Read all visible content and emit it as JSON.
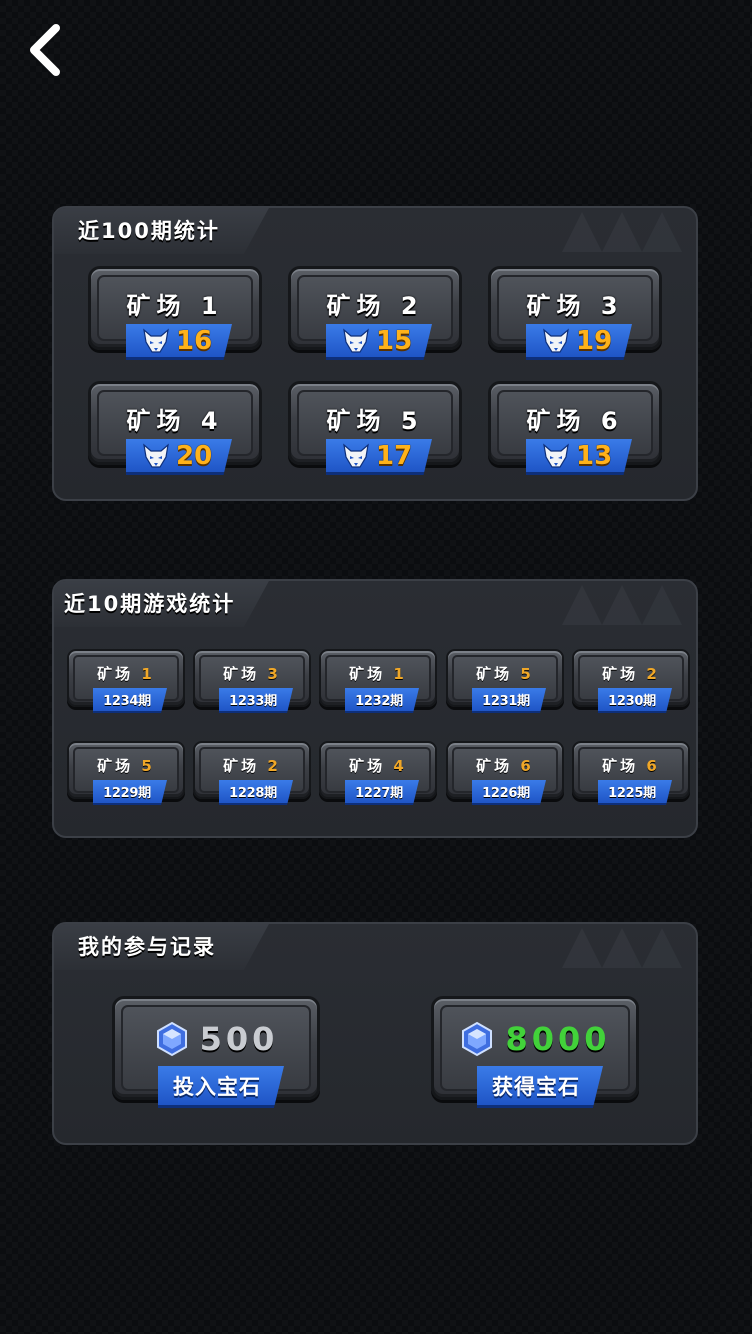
{
  "nav": {
    "back_icon": "chevron-left-icon"
  },
  "stats100": {
    "title": "近100期统计",
    "mines": [
      {
        "name": "矿场 1",
        "count": "16"
      },
      {
        "name": "矿场 2",
        "count": "15"
      },
      {
        "name": "矿场 3",
        "count": "19"
      },
      {
        "name": "矿场 4",
        "count": "20"
      },
      {
        "name": "矿场 5",
        "count": "17"
      },
      {
        "name": "矿场 6",
        "count": "13"
      }
    ]
  },
  "stats10": {
    "title": "近10期游戏统计",
    "mine_label": "矿场",
    "games": [
      {
        "mine": "1",
        "period": "1234期"
      },
      {
        "mine": "3",
        "period": "1233期"
      },
      {
        "mine": "1",
        "period": "1232期"
      },
      {
        "mine": "5",
        "period": "1231期"
      },
      {
        "mine": "2",
        "period": "1230期"
      },
      {
        "mine": "5",
        "period": "1229期"
      },
      {
        "mine": "2",
        "period": "1228期"
      },
      {
        "mine": "4",
        "period": "1227期"
      },
      {
        "mine": "6",
        "period": "1226期"
      },
      {
        "mine": "6",
        "period": "1225期"
      }
    ]
  },
  "my_records": {
    "title": "我的参与记录",
    "invested": {
      "value": "500",
      "label": "投入宝石",
      "color": "#c9ccd1"
    },
    "earned": {
      "value": "8000",
      "label": "获得宝石",
      "color": "#42d23a"
    }
  },
  "colors": {
    "count": "#ffb21a",
    "ribbon": "#2b66d8",
    "mine_num": "#f0a727"
  }
}
